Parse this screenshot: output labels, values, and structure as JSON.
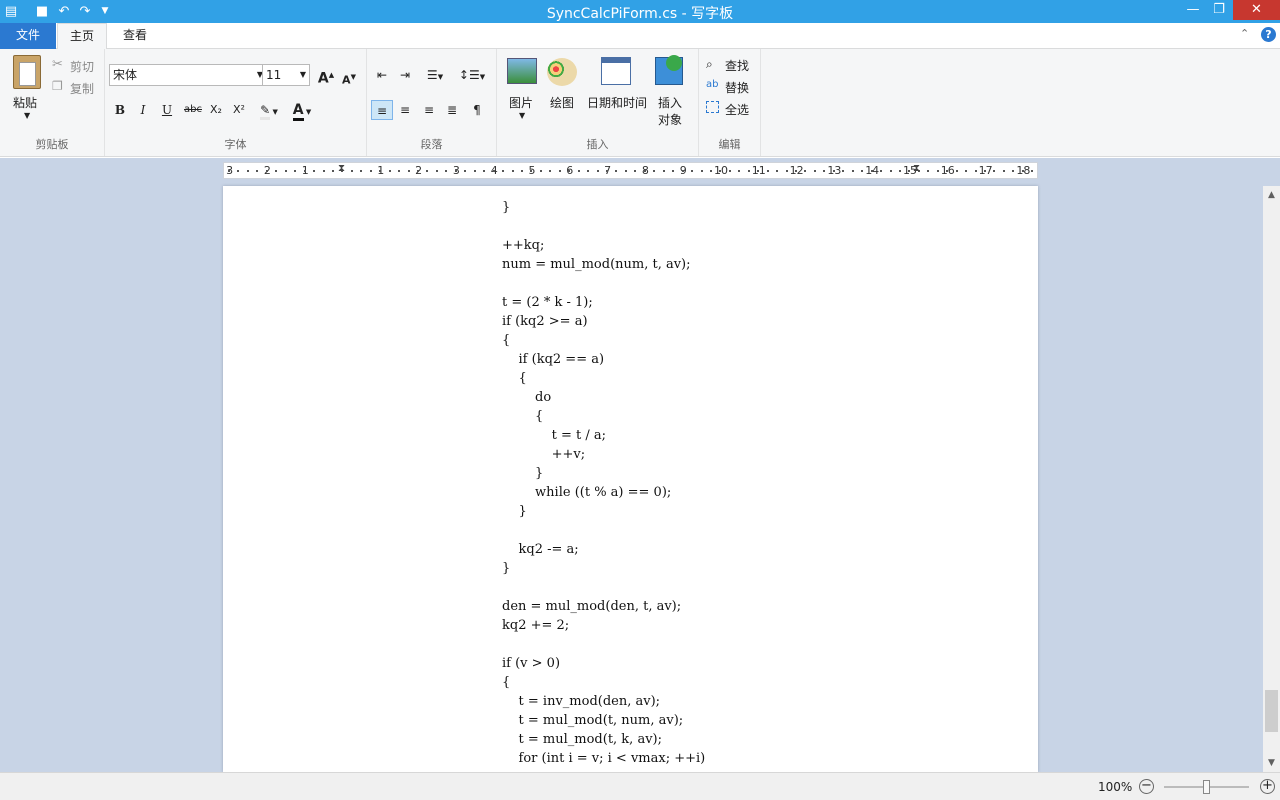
{
  "titlebar": {
    "title": "SyncCalcPiForm.cs - 写字板",
    "minimize": "—",
    "restore": "❐",
    "close": "✕"
  },
  "tabs": {
    "file": "文件",
    "home": "主页",
    "view": "查看"
  },
  "ribbon": {
    "clipboard": {
      "label": "剪贴板",
      "paste": "粘贴",
      "cut": "剪切",
      "copy": "复制"
    },
    "font": {
      "label": "字体",
      "family": "宋体",
      "size": "11",
      "bold": "B",
      "italic": "I",
      "underline": "U",
      "strike": "abc",
      "sub": "X₂",
      "sup": "X²",
      "color_letter": "A"
    },
    "paragraph": {
      "label": "段落"
    },
    "insert": {
      "label": "插入",
      "picture": "图片",
      "paint": "绘图",
      "datetime": "日期和时间",
      "object_1": "插入",
      "object_2": "对象"
    },
    "editing": {
      "label": "编辑",
      "find": "查找",
      "replace": "替换",
      "select_all": "全选"
    }
  },
  "ruler": {
    "ticks": [
      "3",
      "2",
      "1",
      "1",
      "2",
      "3",
      "4",
      "5",
      "6",
      "7",
      "8",
      "9",
      "10",
      "11",
      "12",
      "13",
      "14",
      "15",
      "16",
      "17",
      "18"
    ]
  },
  "document": {
    "lines": [
      "}",
      "",
      "++kq;",
      "num = mul_mod(num, t, av);",
      "",
      "t = (2 * k - 1);",
      "if (kq2 >= a)",
      "{",
      "    if (kq2 == a)",
      "    {",
      "        do",
      "        {",
      "            t = t / a;",
      "            ++v;",
      "        }",
      "        while ((t % a) == 0);",
      "    }",
      "",
      "    kq2 -= a;",
      "}",
      "",
      "den = mul_mod(den, t, av);",
      "kq2 += 2;",
      "",
      "if (v > 0)",
      "{",
      "    t = inv_mod(den, av);",
      "    t = mul_mod(t, num, av);",
      "    t = mul_mod(t, k, av);",
      "    for (int i = v; i < vmax; ++i)"
    ]
  },
  "statusbar": {
    "zoom": "100%",
    "zoom_out": "−",
    "zoom_in": "+"
  }
}
